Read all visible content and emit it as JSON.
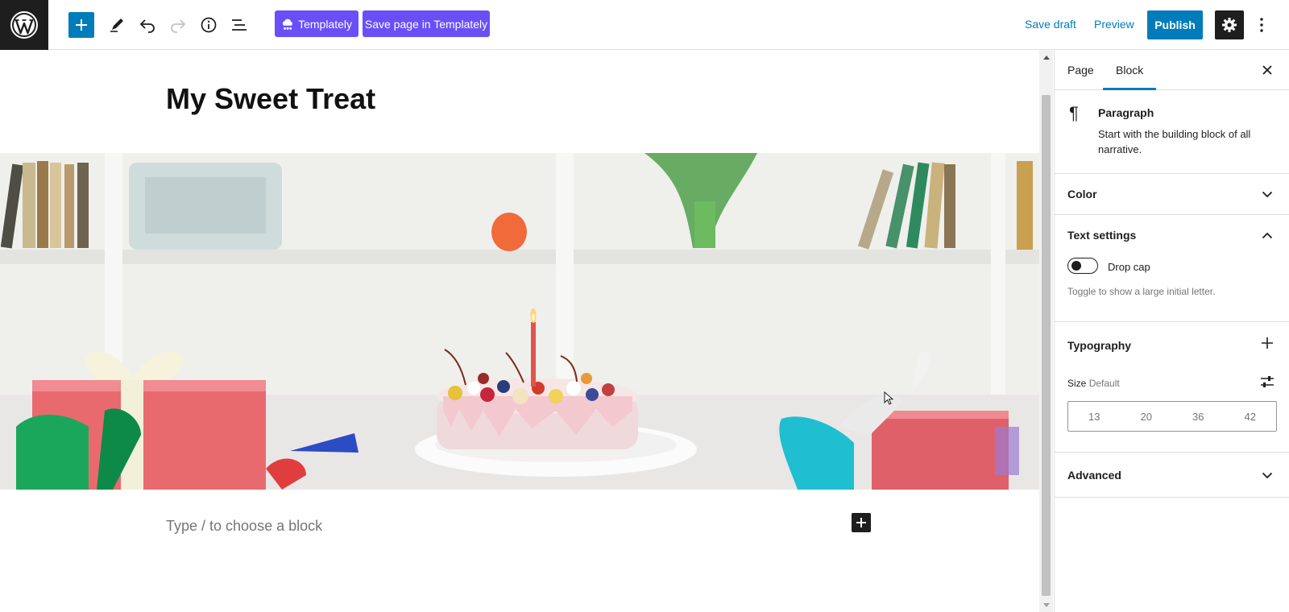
{
  "toolbar": {
    "templately_label": "Templately",
    "save_templately_label": "Save page in Templately",
    "save_draft_label": "Save draft",
    "preview_label": "Preview",
    "publish_label": "Publish",
    "accent_color": "#007cba",
    "templately_color": "#6a4ff7",
    "icons": [
      "wordpress-logo",
      "plus",
      "pencil",
      "undo",
      "redo",
      "info",
      "list-view",
      "gear",
      "more-vertical"
    ]
  },
  "editor": {
    "post_title": "My Sweet Treat",
    "cover_image": "birthday cake with candle and gift boxes on a white table",
    "block_placeholder": "Type / to choose a block"
  },
  "sidebar": {
    "tabs": [
      {
        "label": "Page",
        "active": false
      },
      {
        "label": "Block",
        "active": true
      }
    ],
    "block": {
      "name": "Paragraph",
      "description": "Start with the building block of all narrative."
    },
    "panels": {
      "color": {
        "title": "Color",
        "expanded": false
      },
      "text_settings": {
        "title": "Text settings",
        "expanded": true,
        "drop_cap_label": "Drop cap",
        "drop_cap_on": false,
        "drop_cap_help": "Toggle to show a large initial letter."
      },
      "typography": {
        "title": "Typography",
        "size_label": "Size",
        "size_value": "Default",
        "size_options": [
          "13",
          "20",
          "36",
          "42"
        ]
      },
      "advanced": {
        "title": "Advanced",
        "expanded": false
      }
    }
  }
}
